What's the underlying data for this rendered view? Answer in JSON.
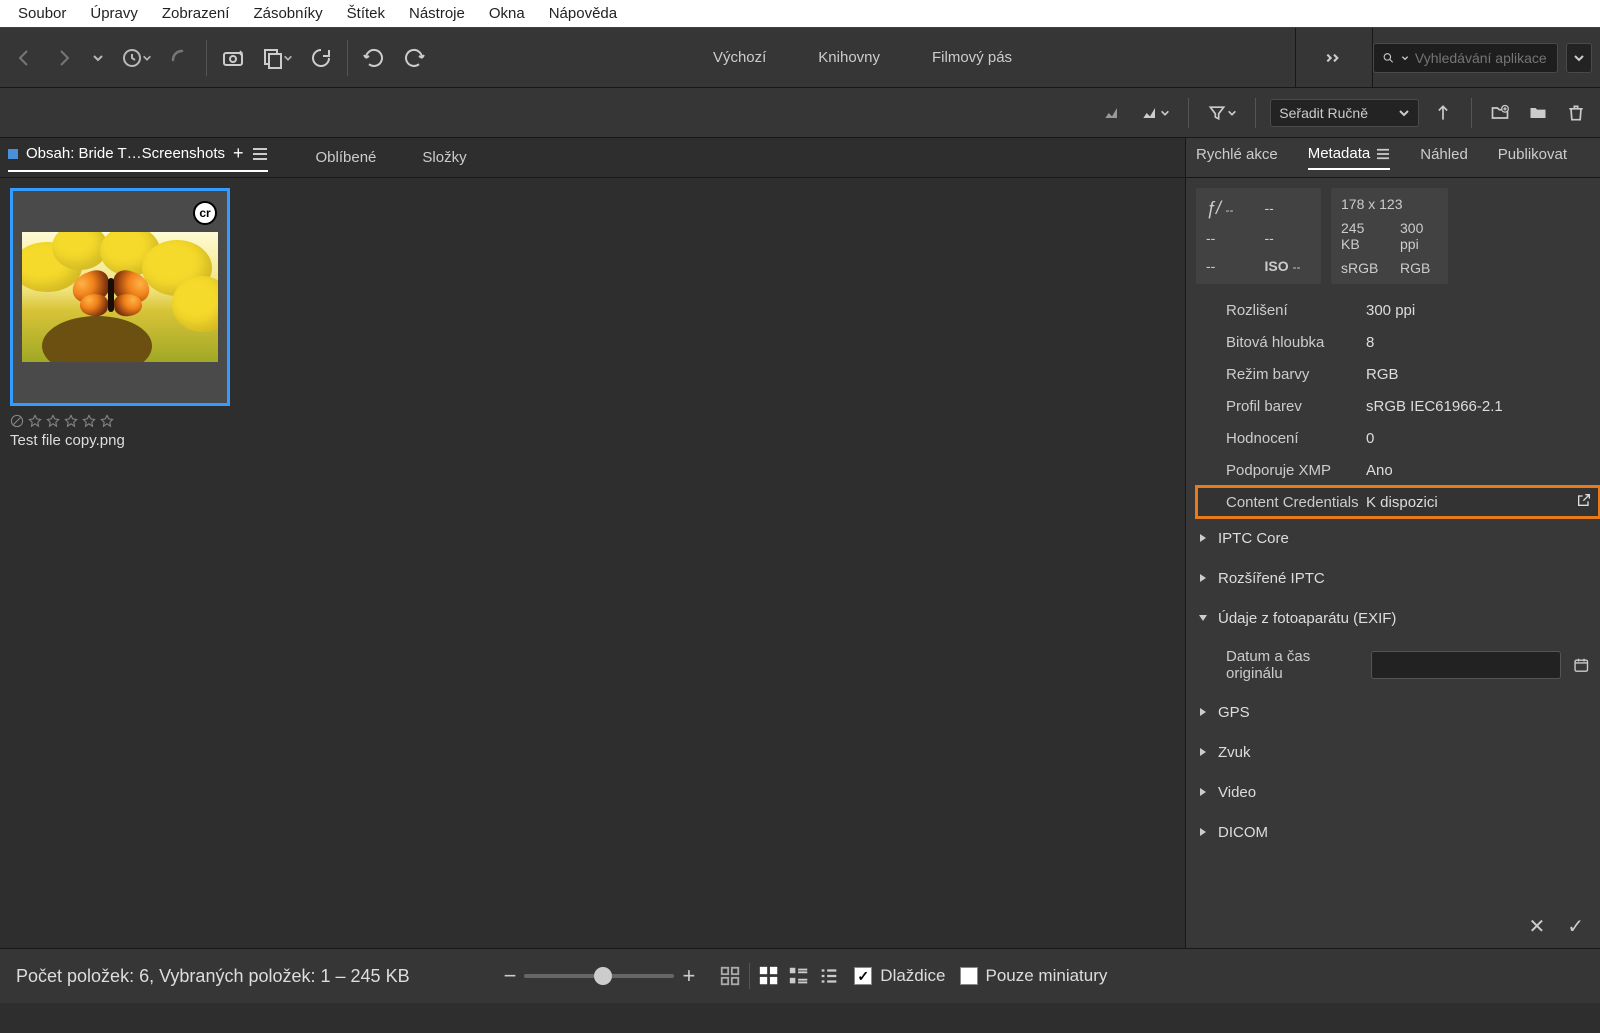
{
  "menu": {
    "items": [
      "Soubor",
      "Úpravy",
      "Zobrazení",
      "Zásobníky",
      "Štítek",
      "Nástroje",
      "Okna",
      "Nápověda"
    ]
  },
  "workspaces": {
    "items": [
      "Výchozí",
      "Knihovny",
      "Filmový pás"
    ]
  },
  "search": {
    "placeholder": "Vyhledávání aplikace B"
  },
  "sort": {
    "label": "Seřadit Ručně"
  },
  "content": {
    "tab_label": "Obsah: Bride T…Screenshots",
    "favorites": "Oblíbené",
    "folders": "Složky"
  },
  "thumbnail": {
    "badge": "cr",
    "filename": "Test file copy.png"
  },
  "right_tabs": {
    "quick": "Rychlé akce",
    "metadata": "Metadata",
    "preview": "Náhled",
    "publish": "Publikovat"
  },
  "exif_box": {
    "fstop": "ƒ/",
    "fstop_val": "--",
    "exposure": "--",
    "ev": "--",
    "flash": "--",
    "focal": "--",
    "iso_label": "ISO",
    "iso_val": "--"
  },
  "file_box": {
    "dims": "178 x 123",
    "size": "245 KB",
    "ppi": "300 ppi",
    "space": "sRGB",
    "mode": "RGB"
  },
  "md_rows": [
    {
      "label": "Rozlišení",
      "value": "300 ppi"
    },
    {
      "label": "Bitová hloubka",
      "value": "8"
    },
    {
      "label": "Režim barvy",
      "value": "RGB"
    },
    {
      "label": "Profil barev",
      "value": "sRGB IEC61966-2.1"
    },
    {
      "label": "Hodnocení",
      "value": "0"
    },
    {
      "label": "Podporuje XMP",
      "value": "Ano"
    }
  ],
  "md_highlight": {
    "label": "Content Credentials",
    "value": "K dispozici"
  },
  "md_sections": {
    "iptc_core": "IPTC Core",
    "iptc_ext": "Rozšířené IPTC",
    "exif": "Údaje z fotoaparátu (EXIF)",
    "exif_date_label": "Datum a čas originálu",
    "gps": "GPS",
    "audio": "Zvuk",
    "video": "Video",
    "dicom": "DICOM"
  },
  "status": {
    "text": "Počet položek: 6, Vybraných položek: 1 – 245 KB",
    "tiles": "Dlaždice",
    "thumbs_only": "Pouze miniatury"
  }
}
